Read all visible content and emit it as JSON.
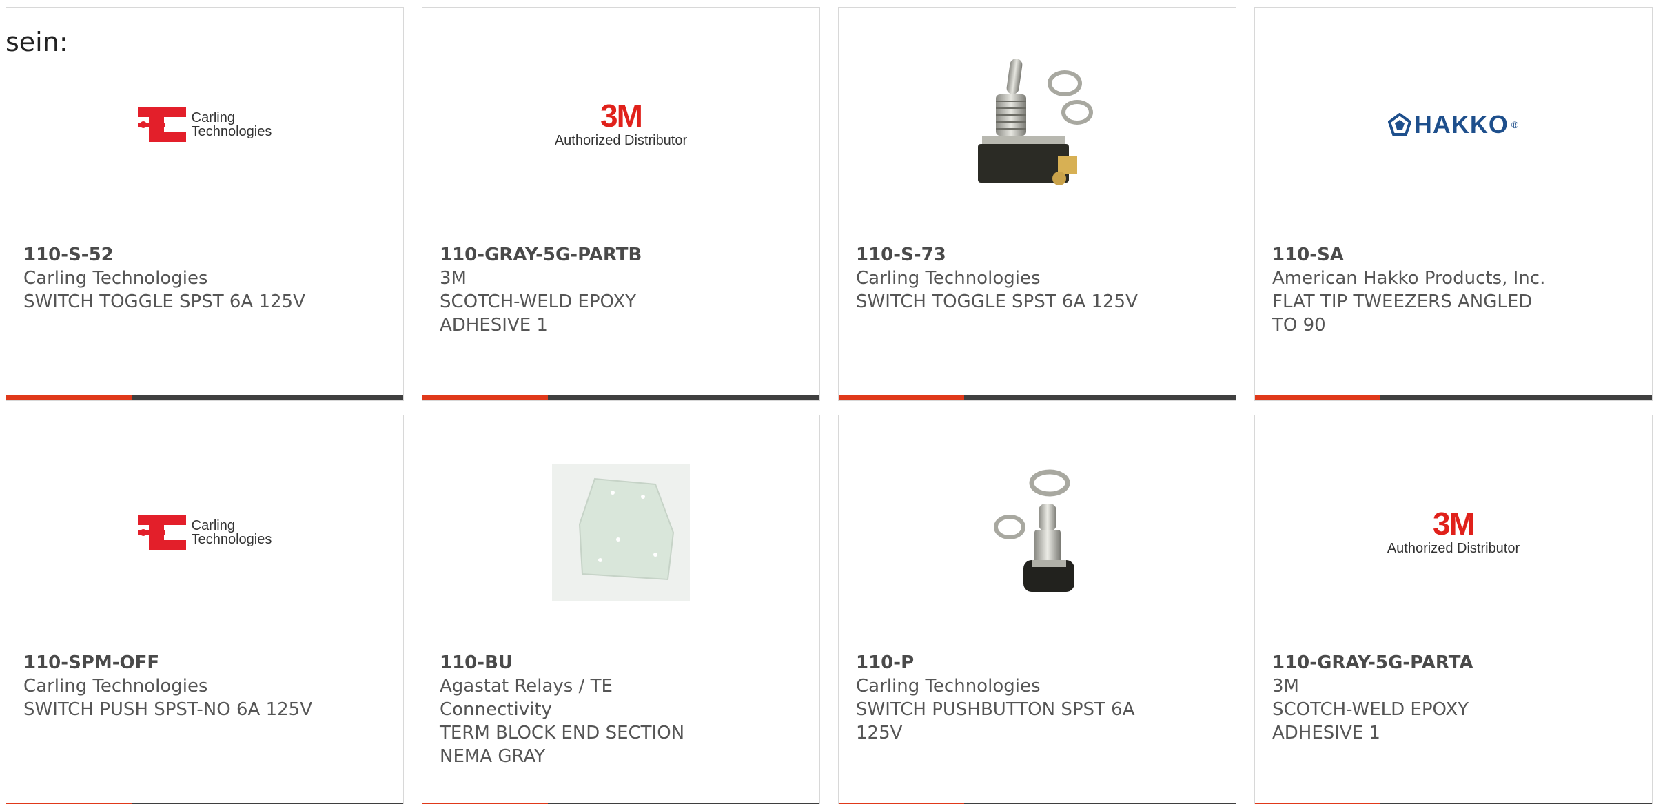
{
  "heading": "sein:",
  "colors": {
    "accent": "#e0391a",
    "bar": "#3f3f3f",
    "card_border": "#d8d8d8",
    "text": "#555555"
  },
  "products": [
    {
      "part_number": "110-S-52",
      "manufacturer": "Carling Technologies",
      "description": "SWITCH TOGGLE SPST 6A 125V",
      "image": "carling-logo",
      "logo_lines": [
        "Carling",
        "Technologies"
      ]
    },
    {
      "part_number": "110-GRAY-5G-PARTB",
      "manufacturer": "3M",
      "description": "SCOTCH-WELD EPOXY ADHESIVE 1",
      "image": "3m-logo",
      "logo_lines": [
        "3M",
        "Authorized Distributor"
      ]
    },
    {
      "part_number": "110-S-73",
      "manufacturer": "Carling Technologies",
      "description": "SWITCH TOGGLE SPST 6A 125V",
      "image": "toggle-switch-photo"
    },
    {
      "part_number": "110-SA",
      "manufacturer": "American Hakko Products, Inc.",
      "description": "FLAT TIP TWEEZERS ANGLED TO 90",
      "image": "hakko-logo",
      "logo_lines": [
        "HAKKO"
      ]
    },
    {
      "part_number": "110-SPM-OFF",
      "manufacturer": "Carling Technologies",
      "description": "SWITCH PUSH SPST-NO 6A 125V",
      "image": "carling-logo",
      "logo_lines": [
        "Carling",
        "Technologies"
      ]
    },
    {
      "part_number": "110-BU",
      "manufacturer": "Agastat Relays / TE Connectivity",
      "description": "TERM BLOCK END SECTION NEMA GRAY",
      "image": "end-section-photo"
    },
    {
      "part_number": "110-P",
      "manufacturer": "Carling Technologies",
      "description": "SWITCH PUSHBUTTON SPST 6A 125V",
      "image": "pushbutton-switch-photo"
    },
    {
      "part_number": "110-GRAY-5G-PARTA",
      "manufacturer": "3M",
      "description": "SCOTCH-WELD EPOXY ADHESIVE 1",
      "image": "3m-logo",
      "logo_lines": [
        "3M",
        "Authorized Distributor"
      ]
    }
  ]
}
